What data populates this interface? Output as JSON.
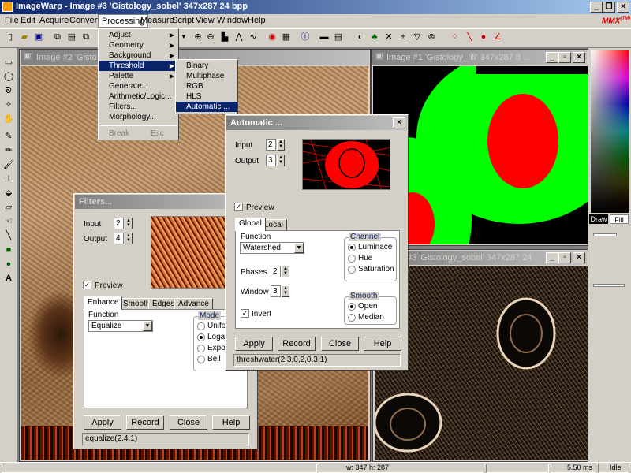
{
  "app": {
    "title": "ImageWarp - Image #3  'Gistology_sobel'  347x287  24  bpp",
    "brand": "MMX",
    "brand_sup": "(TM)"
  },
  "menu": [
    "File",
    "Edit",
    "Acquire",
    "Convert",
    "Processing",
    "Measure",
    "Script",
    "View",
    "Window",
    "Help"
  ],
  "processing_menu": {
    "items": [
      {
        "label": "Adjust",
        "sub": true
      },
      {
        "label": "Geometry",
        "sub": true
      },
      {
        "label": "Background",
        "sub": true
      },
      {
        "label": "Threshold",
        "sub": true
      },
      {
        "label": "Palette",
        "sub": true
      },
      {
        "label": "Generate...",
        "sub": false
      },
      {
        "label": "Arithmetic/Logic...",
        "sub": false
      },
      {
        "label": "Filters...",
        "sub": false
      },
      {
        "label": "Morphology...",
        "sub": false
      }
    ],
    "break_label": "Break",
    "break_shortcut": "Esc"
  },
  "threshold_menu": [
    "Binary",
    "Multiphase",
    "RGB",
    "HLS",
    "Automatic ..."
  ],
  "windows": {
    "image2": "Image #2  'Gisto",
    "image1": "Image #1  'Gistology_fill'  347x287  8 ...",
    "image3": "#3  'Gistology_sobel'  347x287  24..."
  },
  "filters_dialog": {
    "title": "Filters...",
    "input_label": "Input",
    "input_value": "2",
    "output_label": "Output",
    "output_value": "4",
    "preview_label": "Preview",
    "tabs": [
      "Enhance",
      "Smooth",
      "Edges",
      "Advance"
    ],
    "function_label": "Function",
    "function_value": "Equalize",
    "mode_label": "Mode",
    "modes": [
      "Unifor",
      "Logari",
      "Expon",
      "Bell"
    ],
    "buttons": [
      "Apply",
      "Record",
      "Close",
      "Help"
    ],
    "status": "equalize(2,4,1)"
  },
  "auto_dialog": {
    "title": "Automatic ...",
    "input_label": "Input",
    "input_value": "2",
    "output_label": "Output",
    "output_value": "3",
    "preview_label": "Preview",
    "tabs": [
      "Global",
      "Local"
    ],
    "function_label": "Function",
    "function_value": "Watershed",
    "phases_label": "Phases",
    "phases_value": "2",
    "window_label": "Window",
    "window_value": "3",
    "invert_label": "Invert",
    "channel_label": "Channel",
    "channels": [
      "Luminace",
      "Hue",
      "Saturation"
    ],
    "smooth_label": "Smooth",
    "smooth_options": [
      "Open",
      "Median"
    ],
    "buttons": [
      "Apply",
      "Record",
      "Close",
      "Help"
    ],
    "status": "threshwater(2,3,0,2,0,3,1)"
  },
  "palette": {
    "draw_label": "Draw",
    "fill_label": "Fill"
  },
  "status_bar": {
    "size": "w: 347  h: 287",
    "time": "5.50 ms",
    "state": "Idle"
  },
  "colors": {
    "titlebar": "#0a246a",
    "face": "#d4d0c8",
    "segment_green": "#00ff00",
    "segment_red": "#ff0000"
  }
}
